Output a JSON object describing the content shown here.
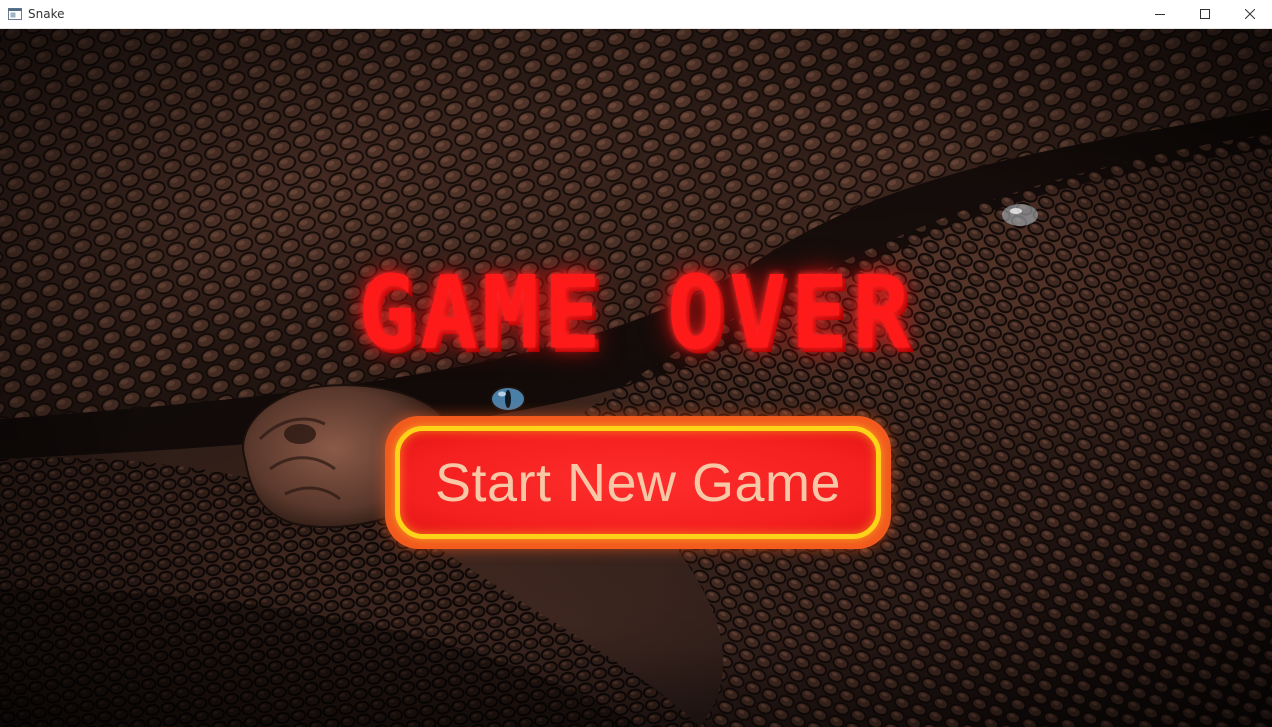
{
  "window": {
    "title": "Snake",
    "icon": "app-window-icon",
    "controls": [
      "minimize-icon",
      "maximize-icon",
      "close-icon"
    ]
  },
  "game": {
    "heading": "GAME OVER",
    "start_button_label": "Start New Game",
    "background": "snake-scales-photo"
  },
  "colors": {
    "heading": "#ff1a1a",
    "button_fill": "#f41f1f",
    "button_border": "#ffd21a",
    "button_outer": "#f25a1e",
    "button_text": "#f7c7a6"
  }
}
